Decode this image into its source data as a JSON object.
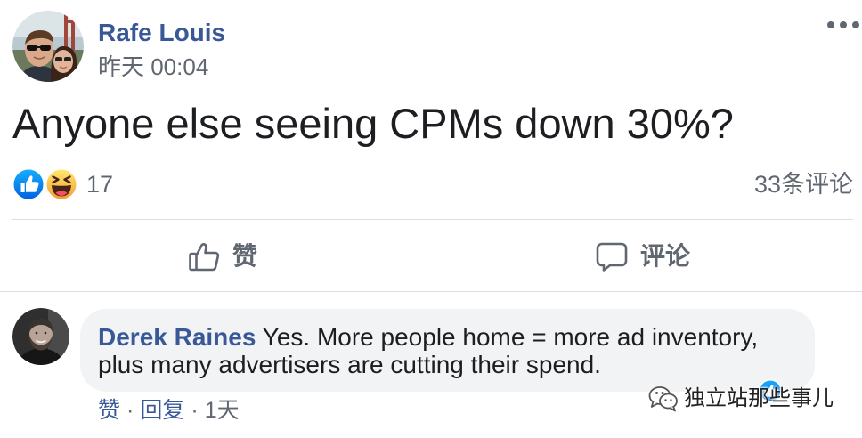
{
  "colors": {
    "author_link": "#385898",
    "text_primary": "#1c1e21",
    "text_secondary": "#606770",
    "divider": "#dadde1",
    "comment_bubble_background": "#f2f3f5",
    "like_reaction_blue": "#1877f2",
    "haha_reaction_yellow": "#f7b125"
  },
  "post": {
    "author_name": "Rafe Louis",
    "timestamp": "昨天 00:04",
    "more_icon": "more-options-icon",
    "text": "Anyone else seeing CPMs down 30%?",
    "reactions": {
      "icons": [
        "like-reaction-icon",
        "haha-reaction-icon"
      ],
      "count": "17"
    },
    "comment_count": "33条评论"
  },
  "actions": {
    "like": {
      "icon": "thumbs-up-outline-icon",
      "label": "赞"
    },
    "comment": {
      "icon": "comment-bubble-icon",
      "label": "评论"
    }
  },
  "comments": [
    {
      "author_name": "Derek Raines",
      "text": "Yes. More people home = more ad inventory, plus many advertisers are cutting their spend.",
      "reaction_icon": "like-reaction-icon",
      "footer": {
        "like": "赞",
        "separator": "·",
        "reply": "回复",
        "time": "1天"
      }
    }
  ],
  "watermark": {
    "icon": "wechat-icon",
    "text": "独立站那些事儿"
  }
}
